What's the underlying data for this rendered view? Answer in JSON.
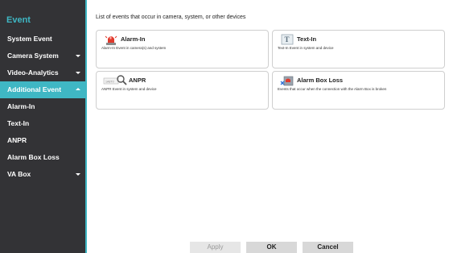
{
  "sidebar": {
    "title": "Event",
    "items": [
      {
        "label": "System Event"
      },
      {
        "label": "Camera System"
      },
      {
        "label": "Video-Analytics"
      },
      {
        "label": "Additional Event"
      },
      {
        "label": "Alarm-In"
      },
      {
        "label": "Text-In"
      },
      {
        "label": "ANPR"
      },
      {
        "label": "Alarm Box Loss"
      },
      {
        "label": "VA Box"
      }
    ]
  },
  "main": {
    "description": "List of events that occur in camera, system, or other devices",
    "cards": [
      {
        "title": "Alarm-In",
        "desc": "Alarm-In Event in camera(s) and system",
        "icon": "alarm-light-icon"
      },
      {
        "title": "Text-In",
        "desc": "Text-In Event in system and device",
        "icon": "text-document-icon"
      },
      {
        "title": "ANPR",
        "desc": "ANPR Event in system and device",
        "icon": "license-plate-search-icon",
        "icon_text": "1A8T0"
      },
      {
        "title": "Alarm Box Loss",
        "desc": "Events that occur when the connection with the Alarm Box is broken",
        "icon": "alarm-box-disconnect-icon"
      }
    ]
  },
  "buttons": {
    "apply": "Apply",
    "ok": "OK",
    "cancel": "Cancel"
  },
  "colors": {
    "accent": "#3fb7c4",
    "sidebar_bg": "#333336"
  }
}
